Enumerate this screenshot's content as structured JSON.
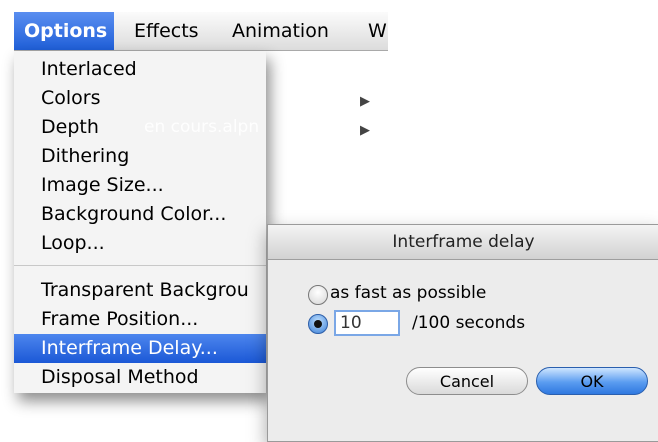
{
  "menubar": {
    "items": [
      {
        "label": "Options",
        "active": true
      },
      {
        "label": "Effects"
      },
      {
        "label": "Animation"
      },
      {
        "label": "W"
      }
    ]
  },
  "options_menu": {
    "items": [
      {
        "label": "Interlaced",
        "submenu": false
      },
      {
        "label": "Colors",
        "submenu": true
      },
      {
        "label": "Depth",
        "submenu": true
      },
      {
        "label": "Dithering",
        "submenu": false
      },
      {
        "label": "Image Size...",
        "submenu": false
      },
      {
        "label": "Background Color...",
        "submenu": false
      },
      {
        "label": "Loop...",
        "submenu": false
      },
      {
        "label": "Transparent Backgrou",
        "submenu": false
      },
      {
        "label": "Frame Position...",
        "submenu": false
      },
      {
        "label": "Interframe Delay...",
        "submenu": false,
        "selected": true
      },
      {
        "label": "Disposal Method",
        "submenu": false
      }
    ]
  },
  "background": {
    "ghost_text": "en cours.alpn"
  },
  "dialog": {
    "title": "Interframe delay",
    "option_fast": "as fast as possible",
    "option_delay_value": "10",
    "option_delay_unit": "/100 seconds",
    "cancel_label": "Cancel",
    "ok_label": "OK",
    "selected_option": "delay"
  },
  "colors": {
    "menu_highlight": "#1f5fd8",
    "default_button": "#5a9cf0"
  }
}
